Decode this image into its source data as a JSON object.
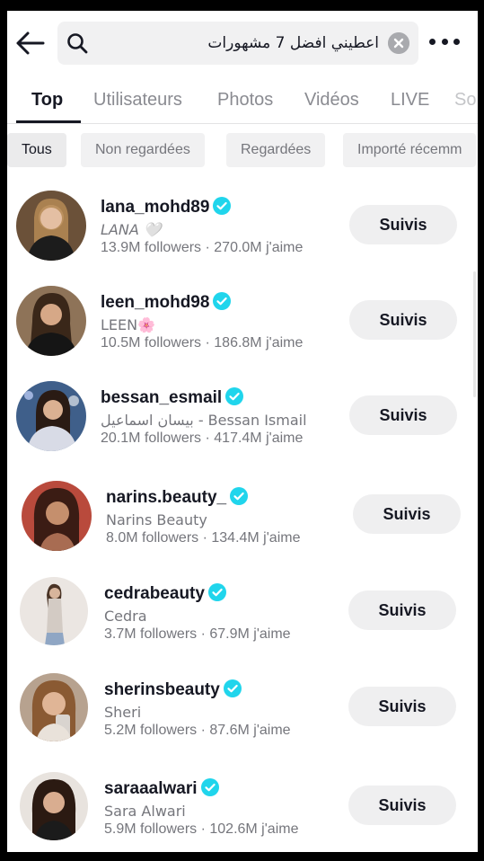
{
  "search": {
    "query": "اعطيني افضل 7 مشهورات"
  },
  "tabs": [
    {
      "label": "Top"
    },
    {
      "label": "Utilisateurs"
    },
    {
      "label": "Photos"
    },
    {
      "label": "Vidéos"
    },
    {
      "label": "LIVE"
    },
    {
      "label": "So"
    }
  ],
  "filters": [
    {
      "label": "Tous"
    },
    {
      "label": "Non regardées"
    },
    {
      "label": "Regardées"
    },
    {
      "label": "Importé récemm"
    }
  ],
  "users": [
    {
      "username": "lana_mohd89",
      "display_name": "LANA 🤍",
      "stats": "13.9M followers · 270.0M j'aime",
      "button": "Suivis"
    },
    {
      "username": "leen_mohd98",
      "display_name": "LEEN🌸",
      "stats": "10.5M followers · 186.8M j'aime",
      "button": "Suivis"
    },
    {
      "username": "bessan_esmail",
      "display_name": "بيسان اسماعيل - Bessan Ismail",
      "stats": "20.1M followers · 417.4M j'aime",
      "button": "Suivis"
    },
    {
      "username": "narins.beauty_",
      "display_name": "Narins Beauty",
      "stats": "8.0M followers · 134.4M j'aime",
      "button": "Suivis"
    },
    {
      "username": "cedrabeauty",
      "display_name": "Cedra",
      "stats": "3.7M followers · 67.9M j'aime",
      "button": "Suivis"
    },
    {
      "username": "sherinsbeauty",
      "display_name": "Sheri",
      "stats": "5.2M followers · 87.6M j'aime",
      "button": "Suivis"
    },
    {
      "username": "saraaalwari",
      "display_name": "Sara Alwari",
      "stats": "5.9M followers · 102.6M j'aime",
      "button": "Suivis"
    }
  ],
  "icons": {
    "back": "arrow-left-icon",
    "search": "search-icon",
    "clear": "clear-icon",
    "more": "more-icon",
    "verified": "verified-badge-icon"
  },
  "colors": {
    "verified": "#20d5ec",
    "text_secondary": "#75767c",
    "button_bg": "#efeff0"
  }
}
